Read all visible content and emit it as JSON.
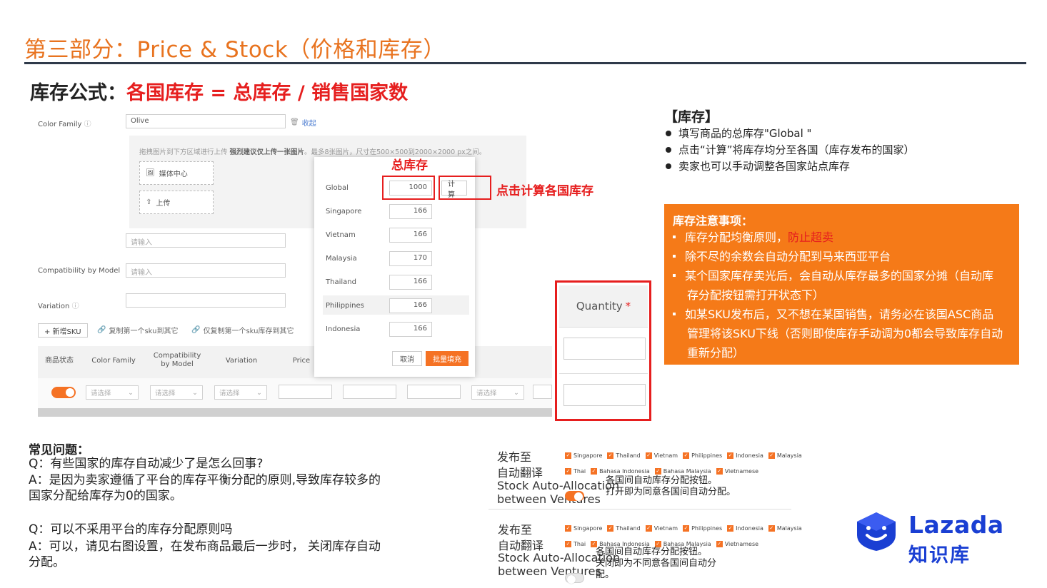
{
  "slide": {
    "title": "第三部分：Price & Stock（价格和库存）",
    "formula_prefix": "库存公式：",
    "formula_body": "各国库存 = 总库存 / 销售国家数"
  },
  "form": {
    "color_family_label": "Color Family",
    "color_family_value": "Olive",
    "collapse_link": "收起",
    "upload_hint_normal": "拖拽图片到下方区域进行上传 ",
    "upload_hint_bold": "强烈建议仅上传一张图片",
    "upload_hint_tail": "。最多8张图片，尺寸在500×500到2000×2000 px之间。",
    "media_center": "媒体中心",
    "upload": "上传",
    "placeholder": "请输入",
    "compatibility_label": "Compatibility by Model",
    "variation_label": "Variation",
    "add_sku": "+ 新增SKU",
    "copy_first_sku": "复制第一个sku到其它",
    "copy_first_sku_stock": "仅复制第一个sku库存到其它"
  },
  "table": {
    "headers": [
      "商品状态",
      "Color Family",
      "Compatibility by Model",
      "Variation",
      "Price"
    ],
    "select_placeholder": "请选择"
  },
  "modal": {
    "rows": [
      {
        "country": "Global",
        "value": "1000"
      },
      {
        "country": "Singapore",
        "value": "166"
      },
      {
        "country": "Vietnam",
        "value": "166"
      },
      {
        "country": "Malaysia",
        "value": "170"
      },
      {
        "country": "Thailand",
        "value": "166"
      },
      {
        "country": "Philippines",
        "value": "166"
      },
      {
        "country": "Indonesia",
        "value": "166"
      }
    ],
    "calc_button": "计算",
    "cancel": "取消",
    "batch_fill": "批量填充"
  },
  "annotations": {
    "total_stock": "总库存",
    "click_calc": "点击计算各国库存"
  },
  "quantity": {
    "label": "Quantity",
    "required": "*"
  },
  "stock_info": {
    "title": "【库存】",
    "bullets": [
      "填写商品的总库存\"Global \"",
      "点击“计算”将库存均分至各国（库存发布的国家）",
      "卖家也可以手动调整各国家站点库存"
    ]
  },
  "notice": {
    "title": "库存注意事项：",
    "item1_a": "库存分配均衡原则，",
    "item1_b": "防止超卖",
    "item2": "除不尽的余数会自动分配到马来西亚平台",
    "item3_l1": "某个国家库存卖光后，会自动从库存最多的国家分摊（自动库",
    "item3_l2": "存分配按钮需打开状态下）",
    "item4_l1": "如某SKU发布后，又不想在某国销售，请务必在该国ASC商品",
    "item4_l2": "管理将该SKU下线（否则即使库存手动调为0都会导致库存自动",
    "item4_l3": "重新分配）"
  },
  "faq": {
    "title": "常见问题：",
    "q1": "Q：有些国家的库存自动减少了是怎么回事?",
    "a1_l1": "A：是因为卖家遵循了平台的库存平衡分配的原则,导致库存较多的",
    "a1_l2": "国家分配给库存为0的国家。",
    "q2": "Q：可以不采用平台的库存分配原则吗",
    "a2_l1": "A：可以，请见右图设置，在发布商品最后一步时， 关闭库存自动",
    "a2_l2": "分配。"
  },
  "settings": {
    "publish_to": "发布至",
    "auto_translate": "自动翻译",
    "auto_alloc_l1": "Stock Auto-Allocation",
    "auto_alloc_l2": "between Ventures",
    "countries": [
      "Singapore",
      "Thailand",
      "Vietnam",
      "Philippines",
      "Indonesia",
      "Malaysia"
    ],
    "languages": [
      "Thai",
      "Bahasa Indonesia",
      "Bahasa Malaysia",
      "Vietnamese"
    ],
    "on_note_l1": "各国间自动库存分配按钮。",
    "on_note_l2": "打开即为同意各国间自动分配。",
    "off_note_l1": "各国间自动库存分配按钮。",
    "off_note_l2": "关闭即为不同意各国间自动分",
    "off_note_l3": "配。"
  },
  "logo": {
    "name": "Lazada",
    "sub": "知识库"
  },
  "colors": {
    "title": "#e8731f",
    "accent_red": "#e61e1e",
    "orange": "#f57a18",
    "brand_blue": "#1a3fd3"
  }
}
